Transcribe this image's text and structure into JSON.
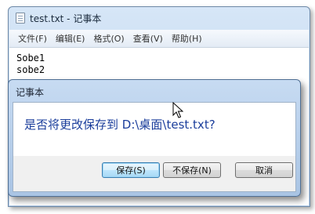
{
  "notepad": {
    "title": "test.txt - 记事本",
    "menus": [
      "文件(F)",
      "编辑(E)",
      "格式(O)",
      "查看(V)",
      "帮助(H)"
    ],
    "lines": [
      "Sobe1",
      "sobe2"
    ]
  },
  "dialog": {
    "title": "记事本",
    "message": "是否将更改保存到 D:\\桌面\\test.txt?",
    "buttons": {
      "save": "保存(S)",
      "dont_save": "不保存(N)",
      "cancel": "取消"
    }
  },
  "icons": {
    "window_icon": "notepad-icon",
    "cursor": "mouse-pointer-icon"
  }
}
